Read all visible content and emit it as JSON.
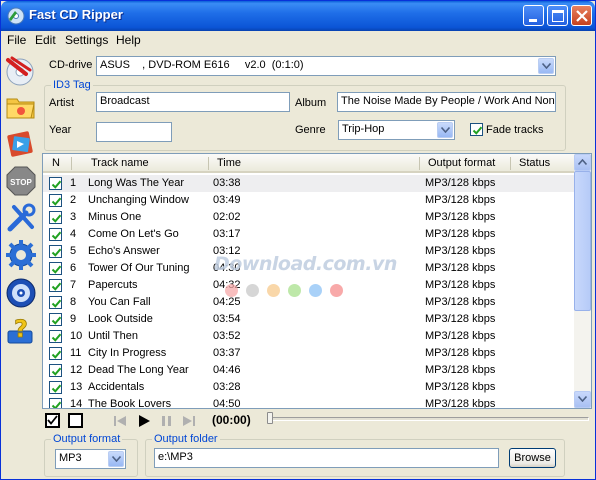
{
  "window": {
    "title": "Fast CD Ripper"
  },
  "menu": {
    "items": [
      "File",
      "Edit",
      "Settings",
      "Help"
    ]
  },
  "toolbar": {
    "icons": [
      "rip-cd-icon",
      "open-folder-icon",
      "encode-icon",
      "stop-icon",
      "tools-icon",
      "settings-icon",
      "cd-info-icon",
      "help-icon"
    ]
  },
  "cd": {
    "label": "CD-drive",
    "drive_value": "ASUS    , DVD-ROM E616     v2.0  (0:1:0)"
  },
  "id3": {
    "title": "ID3 Tag",
    "artist_label": "Artist",
    "artist_value": "Broadcast",
    "album_label": "Album",
    "album_value": "The Noise Made By People / Work And Non",
    "year_label": "Year",
    "year_value": "",
    "genre_label": "Genre",
    "genre_value": "Trip-Hop",
    "fade_label": "Fade tracks",
    "fade_checked": true
  },
  "tracklist": {
    "columns": [
      "N",
      "Track name",
      "Time",
      "Output format",
      "Status"
    ],
    "rows": [
      {
        "n": "1",
        "name": "Long Was The Year",
        "time": "03:38",
        "format": "MP3/128 kbps",
        "status": "",
        "checked": true
      },
      {
        "n": "2",
        "name": "Unchanging Window",
        "time": "03:49",
        "format": "MP3/128 kbps",
        "status": "",
        "checked": true
      },
      {
        "n": "3",
        "name": "Minus One",
        "time": "02:02",
        "format": "MP3/128 kbps",
        "status": "",
        "checked": true
      },
      {
        "n": "4",
        "name": "Come On Let's Go",
        "time": "03:17",
        "format": "MP3/128 kbps",
        "status": "",
        "checked": true
      },
      {
        "n": "5",
        "name": "Echo's Answer",
        "time": "03:12",
        "format": "MP3/128 kbps",
        "status": "",
        "checked": true
      },
      {
        "n": "6",
        "name": "Tower Of Our Tuning",
        "time": "04:30",
        "format": "MP3/128 kbps",
        "status": "",
        "checked": true
      },
      {
        "n": "7",
        "name": "Papercuts",
        "time": "04:32",
        "format": "MP3/128 kbps",
        "status": "",
        "checked": true
      },
      {
        "n": "8",
        "name": "You Can Fall",
        "time": "04:25",
        "format": "MP3/128 kbps",
        "status": "",
        "checked": true
      },
      {
        "n": "9",
        "name": "Look Outside",
        "time": "03:54",
        "format": "MP3/128 kbps",
        "status": "",
        "checked": true
      },
      {
        "n": "10",
        "name": "Until Then",
        "time": "03:52",
        "format": "MP3/128 kbps",
        "status": "",
        "checked": true
      },
      {
        "n": "11",
        "name": "City In Progress",
        "time": "03:37",
        "format": "MP3/128 kbps",
        "status": "",
        "checked": true
      },
      {
        "n": "12",
        "name": "Dead The Long Year",
        "time": "04:46",
        "format": "MP3/128 kbps",
        "status": "",
        "checked": true
      },
      {
        "n": "13",
        "name": "Accidentals",
        "time": "03:28",
        "format": "MP3/128 kbps",
        "status": "",
        "checked": true
      },
      {
        "n": "14",
        "name": "The Book Lovers",
        "time": "04:50",
        "format": "MP3/128 kbps",
        "status": "",
        "checked": true
      }
    ]
  },
  "player": {
    "time": "(00:00)",
    "position": 0
  },
  "output": {
    "format_title": "Output format",
    "format_value": "MP3",
    "folder_title": "Output folder",
    "folder_value": "e:\\MP3",
    "browse_label": "Browse"
  },
  "watermark": {
    "text": "Download.com.vn",
    "dot_colors": [
      "#f6a8a8",
      "#c8c8c8",
      "#f7c98c",
      "#a8e08c",
      "#8cc2f5",
      "#f58c8c"
    ]
  },
  "colors": {
    "title_blue": "#0b55d6",
    "group_title": "#0046d5",
    "check": "#21a121"
  }
}
